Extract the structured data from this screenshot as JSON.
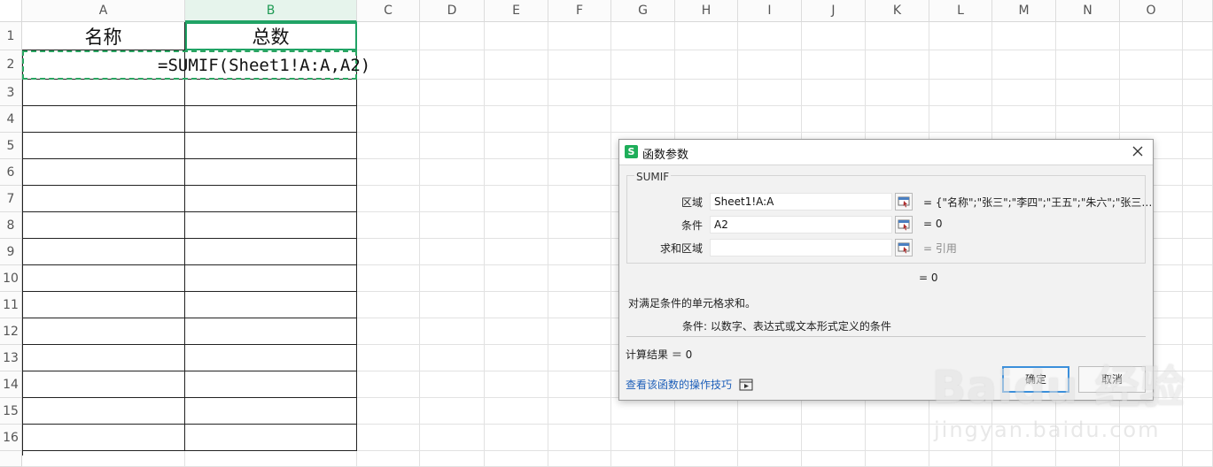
{
  "sheet": {
    "columns": [
      "A",
      "B",
      "C",
      "D",
      "E",
      "F",
      "G",
      "H",
      "I",
      "J",
      "K",
      "L",
      "M",
      "N",
      "O"
    ],
    "rows": [
      "1",
      "2",
      "3",
      "4",
      "5",
      "6",
      "7",
      "8",
      "9",
      "10",
      "11",
      "12",
      "13",
      "14",
      "15",
      "16"
    ],
    "selected_column": "B",
    "cells": {
      "a1": "名称",
      "b1": "总数",
      "a2_formula": "=SUMIF(Sheet1!A:A,A2)"
    },
    "colors": {
      "selection": "#21a366",
      "grid": "#e2e2e2",
      "table_border": "#222222"
    }
  },
  "dialog": {
    "app_icon": "S",
    "title": "函数参数",
    "function_name": "SUMIF",
    "params": [
      {
        "label": "区域",
        "value": "Sheet1!A:A",
        "result": "= {\"名称\";\"张三\";\"李四\";\"王五\";\"朱六\";\"张三…"
      },
      {
        "label": "条件",
        "value": "A2",
        "result": "= 0"
      },
      {
        "label": "求和区域",
        "value": "",
        "result": "= 引用"
      }
    ],
    "formula_result": "= 0",
    "description": "对满足条件的单元格求和。",
    "param_help": "条件:  以数字、表达式或文本形式定义的条件",
    "calc_result": "计算结果 ＝ 0",
    "help_link": "查看该函数的操作技巧",
    "ok_label": "确定",
    "cancel_label": "取消",
    "close_icon": "close-icon"
  },
  "watermark": {
    "logo": "Baidu 经验",
    "url": "jingyan.baidu.com"
  }
}
